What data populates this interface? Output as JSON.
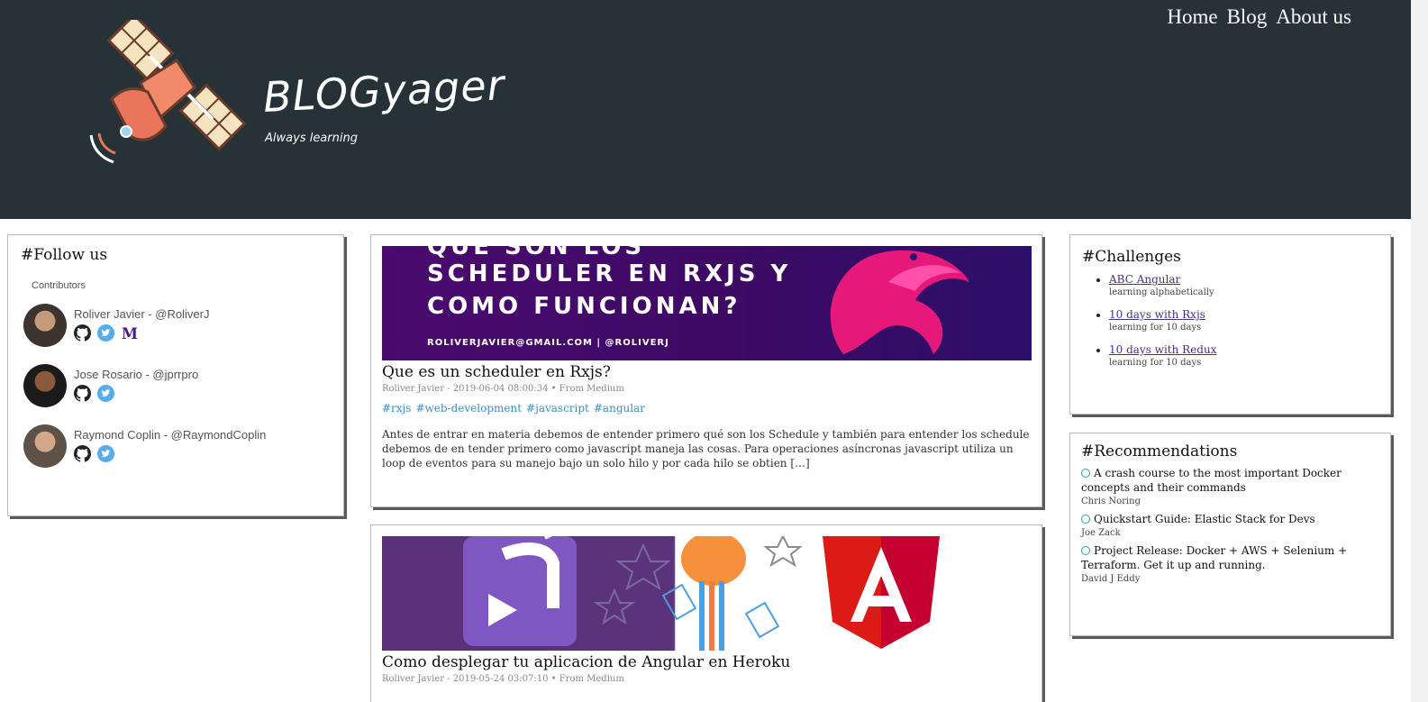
{
  "nav": {
    "home": "Home",
    "blog": "Blog",
    "about": "About us"
  },
  "logo": {
    "title": "BLOGyager",
    "subtitle": "Always learning"
  },
  "follow": {
    "heading": "#Follow us",
    "contributors_label": "Contributors",
    "people": [
      {
        "name": "Roliver Javier - @RoliverJ"
      },
      {
        "name": "Jose Rosario - @jprrpro"
      },
      {
        "name": "Raymond Coplin - @RaymondCoplin"
      }
    ]
  },
  "posts": [
    {
      "banner_lines": [
        "QUE SON LOS",
        "SCHEDULER EN RXJS Y",
        "COMO FUNCIONAN?"
      ],
      "banner_footer": "ROLIVERJAVIER@GMAIL.COM       |       @ROLIVERJ",
      "title": "Que es un scheduler en Rxjs?",
      "meta": "Roliver Javier - 2019-06-04 08:00:34 • From Medium",
      "tags": [
        "#rxjs",
        "#web-development",
        "#javascript",
        "#angular"
      ],
      "excerpt": "Antes de entrar en materia debemos de entender primero qué son los Schedule y también para entender los schedule debemos de en tender primero como javascript maneja las cosas. Para operaciones asíncronas javascript utiliza un loop de eventos para su manejo bajo un solo hilo y por cada hilo se obtien […]"
    },
    {
      "title": "Como desplegar tu aplicacion de Angular en Heroku",
      "meta": "Roliver Javier - 2019-05-24 03:07:10 • From Medium"
    }
  ],
  "challenges": {
    "heading": "#Challenges",
    "items": [
      {
        "title": "ABC Angular",
        "sub": "learning alphabetically"
      },
      {
        "title": "10 days with Rxjs",
        "sub": "learning for 10 days"
      },
      {
        "title": "10 days with Redux",
        "sub": "learning for 10 days"
      }
    ]
  },
  "recommendations": {
    "heading": "#Recommendations",
    "items": [
      {
        "title": "A crash course to the most important Docker concepts and their commands",
        "author": "Chris Noring"
      },
      {
        "title": "Quickstart Guide: Elastic Stack for Devs",
        "author": "Joe Zack"
      },
      {
        "title": "Project Release: Docker + AWS + Selenium + Terraform. Get it up and running.",
        "author": "David J Eddy"
      }
    ]
  },
  "colors": {
    "header_bg": "#263238",
    "tag_blue": "#3a8ec8",
    "link_purple": "#4b2f8a",
    "rec_circle": "#26a69a"
  }
}
